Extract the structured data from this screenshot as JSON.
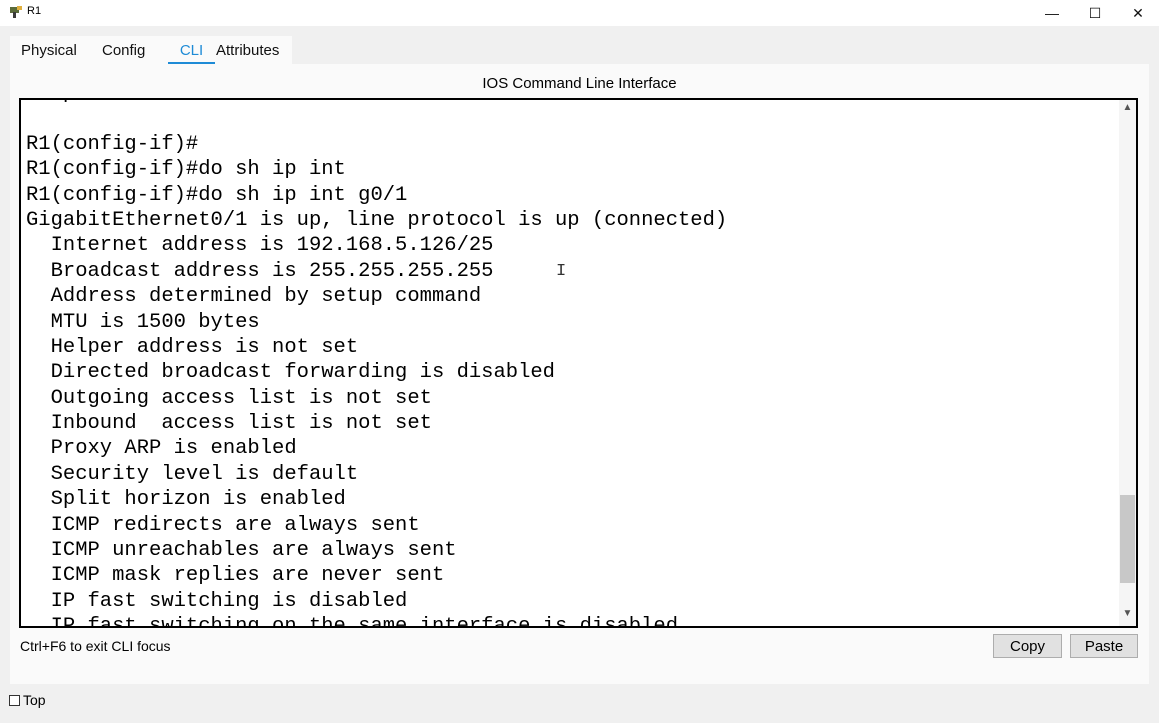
{
  "window": {
    "title": "R1",
    "minimize_glyph": "—",
    "maximize_glyph": "☐",
    "close_glyph": "✕"
  },
  "tabs": [
    {
      "label": "Physical",
      "active": false
    },
    {
      "label": "Config",
      "active": false
    },
    {
      "label": "CLI",
      "active": true
    },
    {
      "label": "Attributes",
      "active": false
    }
  ],
  "cli": {
    "heading": "IOS Command Line Interface",
    "lines": [
      "  up",
      "",
      "R1(config-if)#",
      "R1(config-if)#do sh ip int",
      "R1(config-if)#do sh ip int g0/1",
      "GigabitEthernet0/1 is up, line protocol is up (connected)",
      "  Internet address is 192.168.5.126/25",
      "  Broadcast address is 255.255.255.255",
      "  Address determined by setup command",
      "  MTU is 1500 bytes",
      "  Helper address is not set",
      "  Directed broadcast forwarding is disabled",
      "  Outgoing access list is not set",
      "  Inbound  access list is not set",
      "  Proxy ARP is enabled",
      "  Security level is default",
      "  Split horizon is enabled",
      "  ICMP redirects are always sent",
      "  ICMP unreachables are always sent",
      "  ICMP mask replies are never sent",
      "  IP fast switching is disabled",
      "  IP fast switching on the same interface is disabled"
    ],
    "scroll_up_glyph": "▲",
    "scroll_down_glyph": "▼"
  },
  "footer": {
    "hint": "Ctrl+F6 to exit CLI focus",
    "copy_label": "Copy",
    "paste_label": "Paste",
    "top_label": "Top",
    "top_checked": false
  },
  "colors": {
    "accent": "#1e8bd6",
    "window_bg": "#f0f0f0",
    "panel_bg": "#fafafa",
    "terminal_bg": "#ffffff"
  }
}
